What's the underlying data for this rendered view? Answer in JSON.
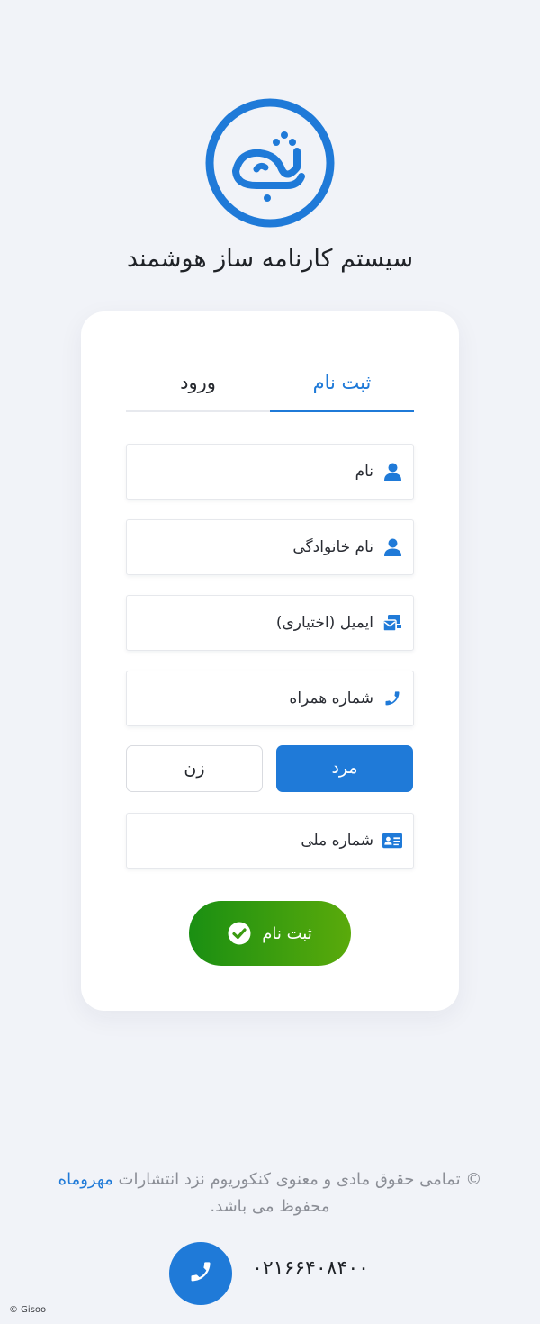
{
  "app": {
    "title": "سیستم کارنامه ساز هوشمند",
    "logo_icon": "brand-logo-icon"
  },
  "tabs": [
    {
      "label": "ثبت نام",
      "active": true
    },
    {
      "label": "ورود",
      "active": false
    }
  ],
  "form": {
    "first_name": {
      "placeholder": "نام",
      "value": "",
      "icon": "user-icon"
    },
    "last_name": {
      "placeholder": "نام خانوادگی",
      "value": "",
      "icon": "user-icon"
    },
    "email": {
      "placeholder": "ایمیل (اختیاری)",
      "value": "",
      "icon": "mail-icon"
    },
    "mobile": {
      "placeholder": "شماره همراه",
      "value": "",
      "icon": "phone-icon"
    },
    "gender": {
      "male_label": "مرد",
      "female_label": "زن",
      "selected": "male"
    },
    "national_id": {
      "placeholder": "شماره ملی",
      "value": "",
      "icon": "id-card-icon"
    },
    "submit_label": "ثبت نام",
    "submit_icon": "check-circle-icon"
  },
  "footer": {
    "copyright_text": "© تمامی حقوق مادی و معنوی کنکوریوم نزد انتشارات",
    "publisher_link": "مهروماه",
    "copyright_suffix": "محفوظ می باشد.",
    "phone_number": "۰۲۱۶۶۴۰۸۴۰۰",
    "phone_icon": "phone-icon",
    "credit": "© Gisoo"
  },
  "colors": {
    "primary": "#1f7ad8",
    "background": "#f1f3f8",
    "success_start": "#1a8f12",
    "success_end": "#5aaa0b"
  }
}
